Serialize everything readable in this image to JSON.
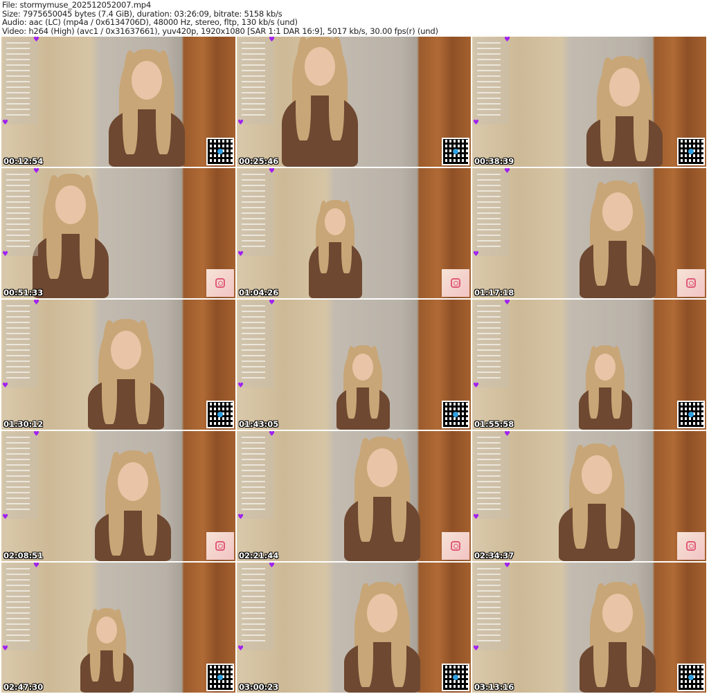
{
  "header": {
    "file": "File: stormymuse_202512052007.mp4",
    "size": "Size: 7975650045 bytes (7.4 GiB), duration: 03:26:09, bitrate: 5158 kb/s",
    "audio": "Audio: aac (LC) (mp4a / 0x6134706D), 48000 Hz, stereo, fltp, 130 kb/s (und)",
    "video": "Video: h264 (High) (avc1 / 0x31637661), yuv420p, 1920x1080 [SAR 1:1 DAR 16:9], 5017 kb/s, 30.00 fps(r) (und)"
  },
  "frames": [
    {
      "timestamp": "00:12:54",
      "overlay": "qr-code"
    },
    {
      "timestamp": "00:25:46",
      "overlay": "qr-code"
    },
    {
      "timestamp": "00:38:39",
      "overlay": "qr-code"
    },
    {
      "timestamp": "00:51:33",
      "overlay": "instagram"
    },
    {
      "timestamp": "01:04:26",
      "overlay": "instagram"
    },
    {
      "timestamp": "01:17:18",
      "overlay": "instagram"
    },
    {
      "timestamp": "01:30:12",
      "overlay": "qr-code"
    },
    {
      "timestamp": "01:43:05",
      "overlay": "qr-code"
    },
    {
      "timestamp": "01:55:58",
      "overlay": "qr-code"
    },
    {
      "timestamp": "02:08:51",
      "overlay": "instagram"
    },
    {
      "timestamp": "02:21:44",
      "overlay": "instagram"
    },
    {
      "timestamp": "02:34:37",
      "overlay": "instagram"
    },
    {
      "timestamp": "02:47:30",
      "overlay": "qr-code"
    },
    {
      "timestamp": "03:00:23",
      "overlay": "qr-code"
    },
    {
      "timestamp": "03:13:16",
      "overlay": "qr-code"
    }
  ]
}
